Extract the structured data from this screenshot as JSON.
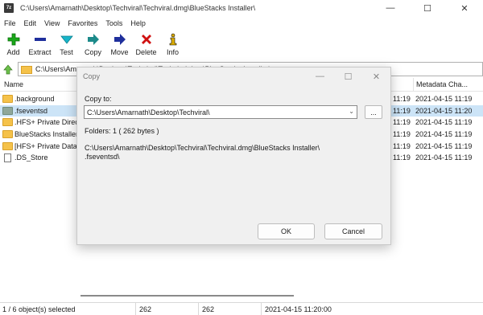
{
  "window": {
    "app_icon_text": "7z",
    "title": "C:\\Users\\Amarnath\\Desktop\\Techviral\\Techviral.dmg\\BlueStacks Installer\\",
    "controls": {
      "minimize": "—",
      "maximize": "☐",
      "close": "✕"
    }
  },
  "menu": [
    "File",
    "Edit",
    "View",
    "Favorites",
    "Tools",
    "Help"
  ],
  "toolbar": [
    {
      "label": "Add",
      "icon": "plus-icon",
      "color": "#1aa81a"
    },
    {
      "label": "Extract",
      "icon": "minus-icon",
      "color": "#1f2f9c"
    },
    {
      "label": "Test",
      "icon": "check-arrow-icon",
      "color": "#17b5c9"
    },
    {
      "label": "Copy",
      "icon": "arrow-right-icon",
      "color": "#1c8a8a"
    },
    {
      "label": "Move",
      "icon": "arrow-right-icon",
      "color": "#1f2f9c"
    },
    {
      "label": "Delete",
      "icon": "x-icon",
      "color": "#d01010"
    },
    {
      "label": "Info",
      "icon": "info-icon",
      "color": "#e0b000"
    }
  ],
  "address": {
    "path": "C:\\Users\\Amarnath\\Desktop\\Techviral\\Techviral.dmg\\BlueStacks Installer\\"
  },
  "list": {
    "columns": {
      "name": "Name",
      "metadata": "Metadata Cha..."
    },
    "rows": [
      {
        "name": ".background",
        "type": "folder",
        "time": "11:19",
        "meta": "2021-04-15 11:19"
      },
      {
        "name": ".fseventsd",
        "type": "folder-dim",
        "time": "11:19",
        "meta": "2021-04-15 11:20",
        "selected": true
      },
      {
        "name": ".HFS+ Private Direct",
        "type": "folder",
        "time": "11:19",
        "meta": "2021-04-15 11:19"
      },
      {
        "name": "BlueStacks Installer",
        "type": "folder",
        "time": "11:19",
        "meta": "2021-04-15 11:19"
      },
      {
        "name": "[HFS+ Private Data]",
        "type": "folder",
        "time": "11:19",
        "meta": "2021-04-15 11:19"
      },
      {
        "name": ".DS_Store",
        "type": "file",
        "time": "11:19",
        "meta": "2021-04-15 11:19"
      }
    ]
  },
  "status": {
    "selection": "1 / 6 object(s) selected",
    "size": "262",
    "packed": "262",
    "modified": "2021-04-15 11:20:00"
  },
  "dialog": {
    "title": "Copy",
    "copy_to_label": "Copy to:",
    "path_value": "C:\\Users\\Amarnath\\Desktop\\Techviral\\",
    "browse_label": "...",
    "folders_info": "Folders: 1    ( 262 bytes )",
    "source_line1": "C:\\Users\\Amarnath\\Desktop\\Techviral\\Techviral.dmg\\BlueStacks Installer\\",
    "source_line2": ".fseventsd\\",
    "ok_label": "OK",
    "cancel_label": "Cancel"
  }
}
